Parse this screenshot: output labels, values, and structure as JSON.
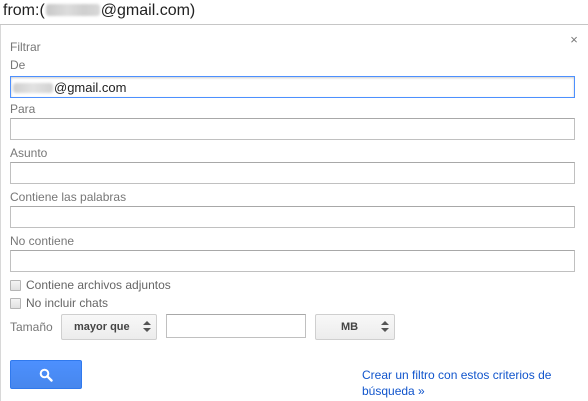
{
  "search_bar": {
    "prefix": "from:(",
    "suffix": "@gmail.com)"
  },
  "filter_panel": {
    "title": "Filtrar",
    "close_glyph": "×",
    "from": {
      "label": "De",
      "value_suffix": "@gmail.com"
    },
    "to": {
      "label": "Para",
      "value": ""
    },
    "subject": {
      "label": "Asunto",
      "value": ""
    },
    "has_words": {
      "label": "Contiene las palabras",
      "value": ""
    },
    "not_has": {
      "label": "No contiene",
      "value": ""
    },
    "has_attachment": {
      "label": "Contiene archivos adjuntos",
      "checked": false
    },
    "no_chats": {
      "label": "No incluir chats",
      "checked": false
    },
    "size": {
      "label": "Tamaño",
      "operator": "mayor que",
      "value": "",
      "unit": "MB"
    },
    "search_button_icon": "magnifier-icon",
    "create_filter_link": "Crear un filtro con estos criterios de búsqueda »"
  },
  "colors": {
    "accent": "#4d90fe",
    "link": "#1155cc",
    "label": "#777777"
  }
}
